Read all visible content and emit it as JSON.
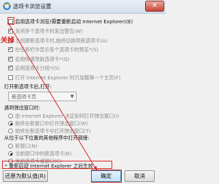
{
  "window": {
    "title": "选项卡浏览设置",
    "close_glyph": "✕"
  },
  "annotation": "关掉",
  "options": [
    {
      "label": "启用选项卡浏览(需要重新启动 Internet Explorer)(E)",
      "checked": false,
      "enabled": true
    },
    {
      "label": "关闭多个选项卡时发出警告(W)",
      "checked": true,
      "enabled": false
    },
    {
      "label": "当创建新选项卡时,始终切换到新选项卡(A)",
      "checked": false,
      "enabled": false
    },
    {
      "label": "在任务栏中显示各个选项卡的预览*(S)",
      "checked": true,
      "enabled": false
    },
    {
      "label": "启用快速导航选项卡*(Q)",
      "checked": true,
      "enabled": false
    },
    {
      "label": "启用选项卡分组*(G)",
      "checked": true,
      "enabled": false
    },
    {
      "label": "打开 Internet Explorer 时只加载第一个主页(F)",
      "checked": false,
      "enabled": false
    }
  ],
  "new_tab": {
    "heading": "打开新选项卡后,打开:",
    "selected": "新选项卡页"
  },
  "popups": {
    "heading": "遇到弹出窗口时:",
    "options": [
      {
        "label": "由 Internet Explorer 决定如何打开弹出窗口(I)",
        "selected": false
      },
      {
        "label": "始终在新窗口中打开弹出窗口(W)",
        "selected": true
      },
      {
        "label": "始终在新选项卡中打开弹出窗口(T)",
        "selected": false
      }
    ]
  },
  "links": {
    "heading": "从位于以下位置的其他程序中打开链接:",
    "options": [
      {
        "label": "新窗口(N)",
        "selected": false
      },
      {
        "label": "当前窗口中的新选项卡(B)",
        "selected": true
      },
      {
        "label": "当前选项卡或窗口(C)",
        "selected": false
      }
    ]
  },
  "notice": "* 重新启动 Internet Explorer 之后生效",
  "buttons": {
    "restore": "还原为默认值(R)",
    "ok": "确定",
    "cancel": "取消"
  },
  "colors": {
    "annotation_red": "#d4201c"
  }
}
